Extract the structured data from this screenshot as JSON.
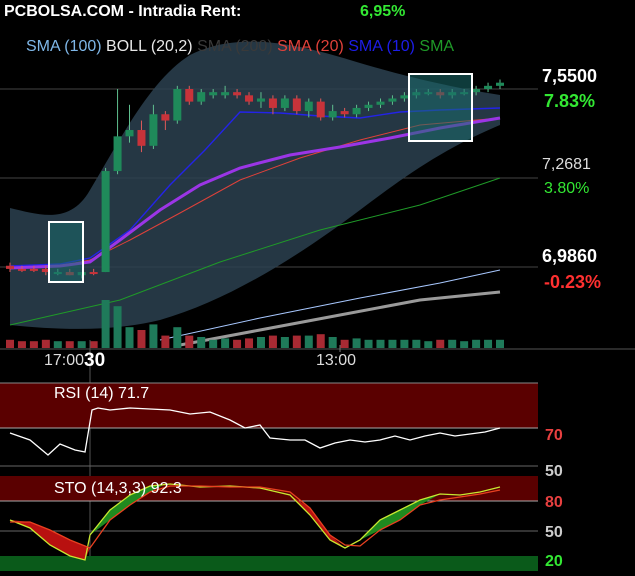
{
  "header": {
    "title": "PCBOLSA.COM - Intradia  Rent:",
    "rent": "6,95%"
  },
  "legend": [
    {
      "label": "SMA (100)",
      "color": "#7fb7e8"
    },
    {
      "label": "BOLL (20,2)",
      "color": "#e8e8e8"
    },
    {
      "label": "SMA (200)",
      "color": "#3a3a3a"
    },
    {
      "label": "SMA (20)",
      "color": "#e0413a"
    },
    {
      "label": "SMA (10)",
      "color": "#1d1de8"
    },
    {
      "label": "SMA",
      "color": "#1f9a28"
    }
  ],
  "price_axis": [
    {
      "price": "7,5500",
      "pct": "7.83%",
      "pct_color": "#33e833"
    },
    {
      "price": "7,2681",
      "pct": "3.80%",
      "pct_color": "#33e833"
    },
    {
      "price": "6,9860",
      "pct": "-0.23%",
      "pct_color": "#ff3030"
    }
  ],
  "time_axis": [
    {
      "label": "17:00"
    },
    {
      "label": "30"
    },
    {
      "label": "13:00"
    }
  ],
  "rsi": {
    "label": "RSI (14) 71.7",
    "levels": [
      "70",
      "50"
    ]
  },
  "sto": {
    "label": "STO (14,3,3) 92.3",
    "levels": [
      "80",
      "50",
      "20"
    ]
  },
  "chart_data": {
    "type": "candlestick",
    "y_axis_levels": [
      6.986,
      7.2681,
      7.55
    ],
    "candles": [
      {
        "o": 6.99,
        "h": 7.0,
        "l": 6.97,
        "c": 6.98,
        "dir": "down"
      },
      {
        "o": 6.98,
        "h": 6.99,
        "l": 6.97,
        "c": 6.98,
        "dir": "down"
      },
      {
        "o": 6.98,
        "h": 6.99,
        "l": 6.97,
        "c": 6.98,
        "dir": "down"
      },
      {
        "o": 6.98,
        "h": 6.99,
        "l": 6.96,
        "c": 6.97,
        "dir": "down"
      },
      {
        "o": 6.97,
        "h": 6.98,
        "l": 6.96,
        "c": 6.97,
        "dir": "up"
      },
      {
        "o": 6.97,
        "h": 6.98,
        "l": 6.96,
        "c": 6.96,
        "dir": "down"
      },
      {
        "o": 6.96,
        "h": 6.97,
        "l": 6.95,
        "c": 6.97,
        "dir": "up"
      },
      {
        "o": 6.97,
        "h": 6.98,
        "l": 6.96,
        "c": 6.97,
        "dir": "down"
      },
      {
        "o": 6.97,
        "h": 7.3,
        "l": 6.97,
        "c": 7.29,
        "dir": "up"
      },
      {
        "o": 7.29,
        "h": 7.55,
        "l": 7.28,
        "c": 7.4,
        "dir": "up"
      },
      {
        "o": 7.4,
        "h": 7.5,
        "l": 7.38,
        "c": 7.42,
        "dir": "up"
      },
      {
        "o": 7.42,
        "h": 7.45,
        "l": 7.35,
        "c": 7.37,
        "dir": "down"
      },
      {
        "o": 7.37,
        "h": 7.5,
        "l": 7.36,
        "c": 7.47,
        "dir": "up"
      },
      {
        "o": 7.47,
        "h": 7.48,
        "l": 7.42,
        "c": 7.45,
        "dir": "down"
      },
      {
        "o": 7.45,
        "h": 7.56,
        "l": 7.44,
        "c": 7.55,
        "dir": "up"
      },
      {
        "o": 7.55,
        "h": 7.56,
        "l": 7.5,
        "c": 7.51,
        "dir": "down"
      },
      {
        "o": 7.51,
        "h": 7.55,
        "l": 7.5,
        "c": 7.54,
        "dir": "up"
      },
      {
        "o": 7.54,
        "h": 7.55,
        "l": 7.52,
        "c": 7.53,
        "dir": "up"
      },
      {
        "o": 7.53,
        "h": 7.56,
        "l": 7.52,
        "c": 7.54,
        "dir": "up"
      },
      {
        "o": 7.54,
        "h": 7.55,
        "l": 7.52,
        "c": 7.53,
        "dir": "down"
      },
      {
        "o": 7.53,
        "h": 7.54,
        "l": 7.5,
        "c": 7.51,
        "dir": "down"
      },
      {
        "o": 7.51,
        "h": 7.54,
        "l": 7.49,
        "c": 7.52,
        "dir": "up"
      },
      {
        "o": 7.52,
        "h": 7.53,
        "l": 7.47,
        "c": 7.49,
        "dir": "down"
      },
      {
        "o": 7.49,
        "h": 7.53,
        "l": 7.48,
        "c": 7.52,
        "dir": "up"
      },
      {
        "o": 7.52,
        "h": 7.53,
        "l": 7.47,
        "c": 7.48,
        "dir": "down"
      },
      {
        "o": 7.48,
        "h": 7.52,
        "l": 7.46,
        "c": 7.51,
        "dir": "up"
      },
      {
        "o": 7.51,
        "h": 7.52,
        "l": 7.45,
        "c": 7.46,
        "dir": "down"
      },
      {
        "o": 7.46,
        "h": 7.5,
        "l": 7.45,
        "c": 7.48,
        "dir": "up"
      },
      {
        "o": 7.48,
        "h": 7.49,
        "l": 7.46,
        "c": 7.47,
        "dir": "down"
      },
      {
        "o": 7.47,
        "h": 7.5,
        "l": 7.46,
        "c": 7.49,
        "dir": "up"
      },
      {
        "o": 7.49,
        "h": 7.51,
        "l": 7.48,
        "c": 7.5,
        "dir": "up"
      },
      {
        "o": 7.5,
        "h": 7.52,
        "l": 7.49,
        "c": 7.51,
        "dir": "up"
      },
      {
        "o": 7.51,
        "h": 7.53,
        "l": 7.5,
        "c": 7.52,
        "dir": "up"
      },
      {
        "o": 7.52,
        "h": 7.54,
        "l": 7.51,
        "c": 7.53,
        "dir": "up"
      },
      {
        "o": 7.53,
        "h": 7.55,
        "l": 7.52,
        "c": 7.54,
        "dir": "up"
      },
      {
        "o": 7.54,
        "h": 7.55,
        "l": 7.53,
        "c": 7.54,
        "dir": "up"
      },
      {
        "o": 7.54,
        "h": 7.55,
        "l": 7.52,
        "c": 7.53,
        "dir": "down"
      },
      {
        "o": 7.53,
        "h": 7.55,
        "l": 7.52,
        "c": 7.54,
        "dir": "up"
      },
      {
        "o": 7.54,
        "h": 7.55,
        "l": 7.53,
        "c": 7.54,
        "dir": "up"
      },
      {
        "o": 7.54,
        "h": 7.56,
        "l": 7.53,
        "c": 7.55,
        "dir": "up"
      },
      {
        "o": 7.55,
        "h": 7.57,
        "l": 7.54,
        "c": 7.56,
        "dir": "up"
      },
      {
        "o": 7.56,
        "h": 7.58,
        "l": 7.55,
        "c": 7.57,
        "dir": "up"
      }
    ]
  }
}
